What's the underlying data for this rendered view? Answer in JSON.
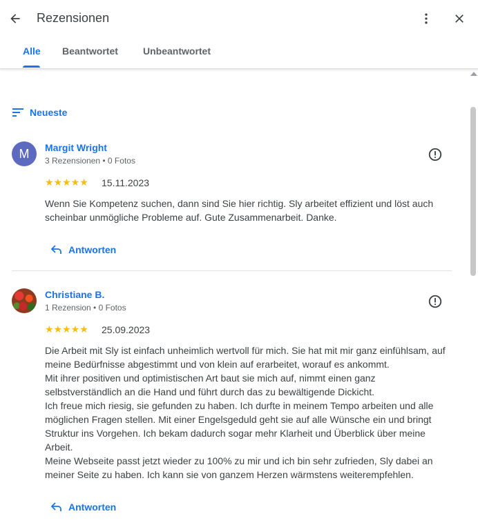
{
  "header": {
    "title": "Rezensionen",
    "back_icon": "arrow-back-icon",
    "more_icon": "more-vert-icon",
    "close_icon": "close-icon"
  },
  "tabs": [
    {
      "label": "Alle",
      "active": true
    },
    {
      "label": "Beantwortet",
      "active": false
    },
    {
      "label": "Unbeantwortet",
      "active": false
    }
  ],
  "sort": {
    "label": "Neueste",
    "icon": "sort-icon"
  },
  "colors": {
    "accent": "#1a73e8",
    "star": "#fbbc04",
    "avatar_m": "#5c6bc0"
  },
  "reviews": [
    {
      "avatar_letter": "M",
      "name": "Margit Wright",
      "meta": "3 Rezensionen • 0 Fotos",
      "rating": 5,
      "stars": "★★★★★",
      "date": "15.11.2023",
      "text": "Wenn Sie Kompetenz suchen, dann sind Sie hier richtig. Sly arbeitet effizient und löst auch scheinbar unmögliche Probleme auf. Gute Zusammenarbeit. Danke.",
      "reply_label": "Antworten"
    },
    {
      "avatar_letter": "",
      "name": "Christiane B.",
      "meta": "1 Rezension • 0 Fotos",
      "rating": 5,
      "stars": "★★★★★",
      "date": "25.09.2023",
      "text_lines": [
        "Die Arbeit mit Sly ist einfach unheimlich wertvoll für mich. Sie hat mit mir ganz einfühlsam, auf meine Bedürfnisse abgestimmt und von klein auf erarbeitet, worauf es ankommt.",
        "Mit ihrer positiven und optimistischen Art baut sie mich auf, nimmt einen ganz selbstverständlich an die Hand und führt durch das zu bewältigende Dickicht.",
        "Ich freue mich riesig, sie gefunden zu haben. Ich durfte in meinem Tempo arbeiten und alle möglichen Fragen stellen. Mit einer Engelsgeduld geht sie auf alle Wünsche ein und bringt Struktur ins Vorgehen. Ich bekam dadurch sogar mehr Klarheit und Überblick über meine Arbeit.",
        "Meine Webseite passt jetzt wieder zu 100% zu mir und ich bin sehr zufrieden, Sly dabei an meiner Seite zu haben. Ich kann sie von ganzem Herzen wärmstens weiterempfehlen."
      ],
      "reply_label": "Antworten"
    }
  ]
}
